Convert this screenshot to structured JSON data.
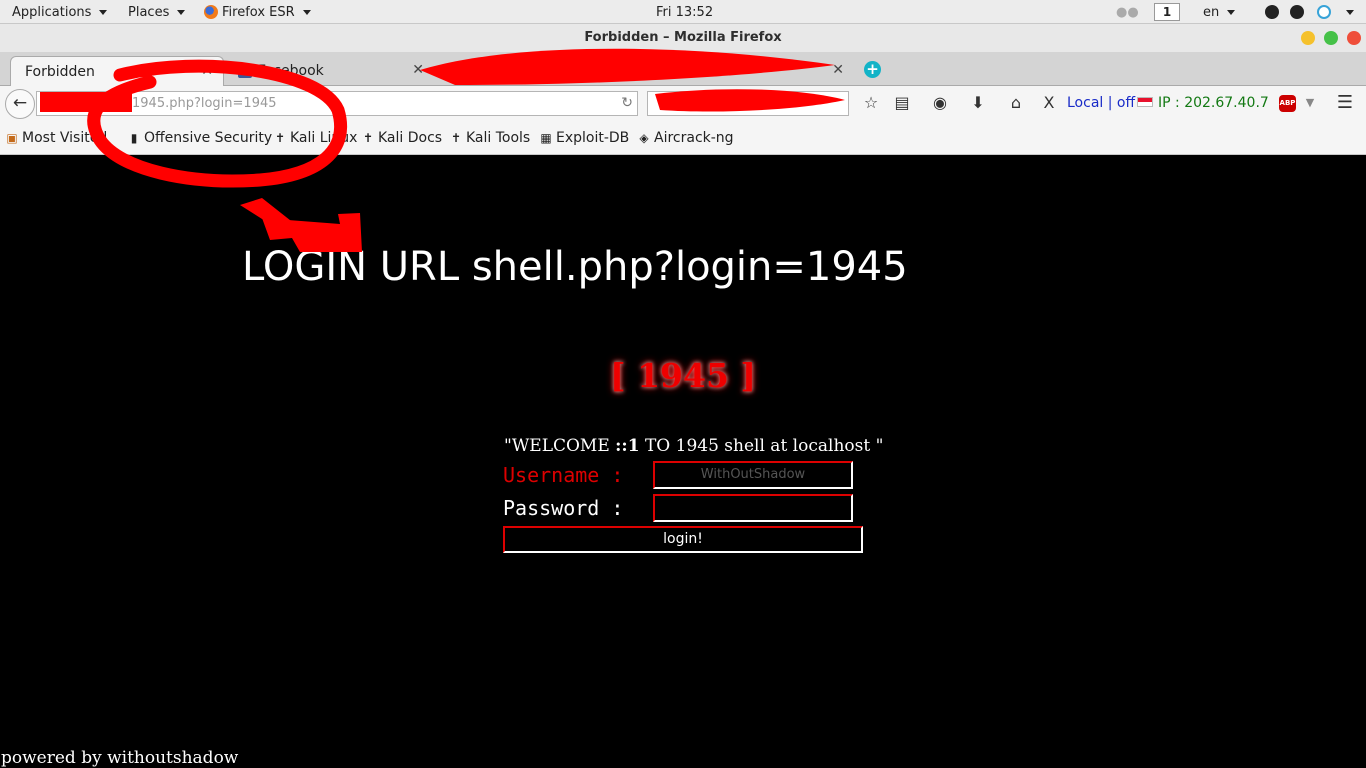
{
  "topbar": {
    "applications": "Applications",
    "places": "Places",
    "app_name": "Firefox ESR",
    "clock": "Fri 13:52",
    "workspace": "1",
    "lang": "en"
  },
  "window": {
    "title": "Forbidden – Mozilla Firefox"
  },
  "tabs": [
    {
      "label": "Forbidden"
    },
    {
      "label": "Facebook"
    }
  ],
  "nav": {
    "url": "1945.php?login=1945",
    "local_label": "Local | off",
    "ip_label": "IP : 202.67.40.7",
    "abp_label": "ABP"
  },
  "bookmarks": [
    "Most Visited",
    "Offensive Security",
    "Kali Linux",
    "Kali Docs",
    "Kali Tools",
    "Exploit-DB",
    "Aircrack-ng"
  ],
  "page": {
    "annotation": "LOGIN URL shell.php?login=1945",
    "heading": "[ 1945 ]",
    "welcome_prefix": "\"WELCOME ",
    "welcome_ip": "::1",
    "welcome_suffix": " TO 1945 shell at localhost \"",
    "username_label": "Username :",
    "password_label": "Password :",
    "username_placeholder": "WithOutShadow",
    "login_button": "login!",
    "footer": "powered by withoutshadow"
  },
  "colors": {
    "label_red": "#dd0000",
    "label_white": "#ffffff",
    "ip_green": "#137913",
    "local_blue": "#1a2cc8"
  }
}
